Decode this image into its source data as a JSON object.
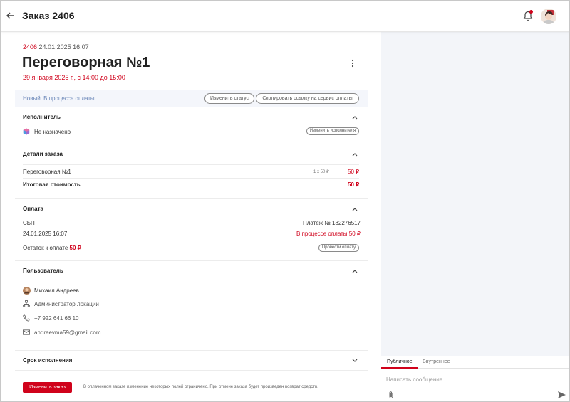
{
  "header": {
    "title": "Заказ 2406"
  },
  "order": {
    "number": "2406",
    "created": "24.01.2025 16:07",
    "room_title": "Переговорная №1",
    "date_line": "29 января 2025 г., с 14:00 до 15:00"
  },
  "status": {
    "text": "Новый. В процессе оплаты",
    "change_status_label": "Изменить статус",
    "copy_link_label": "Скопировать ссылку на сервис оплаты"
  },
  "executor": {
    "title": "Исполнитель",
    "value": "Не назначено",
    "change_label": "Изменить исполнителя"
  },
  "details": {
    "title": "Детали заказа",
    "item_name": "Переговорная №1",
    "item_qty": "1 x 50 ₽",
    "item_price": "50 ₽",
    "total_label": "Итоговая стоимость",
    "total_value": "50 ₽"
  },
  "payment": {
    "title": "Оплата",
    "method": "СБП",
    "payment_id": "Платеж № 182276517",
    "datetime": "24.01.2025 16:07",
    "status": "В процессе оплаты 50 ₽",
    "remaining_label": "Остаток к оплате",
    "remaining_value": "50 ₽",
    "pay_button_label": "Провести оплату"
  },
  "user": {
    "title": "Пользователь",
    "name": "Михаил Андреев",
    "role": "Администратор локации",
    "phone": "+7 922 641 66 10",
    "email": "andreevma59@gmail.com"
  },
  "deadline": {
    "title": "Срок исполнения"
  },
  "footer": {
    "edit_button_label": "Изменить заказ",
    "note": "В оплаченном заказе изменение некоторых полей ограничено. При отмене заказа будет произведен возврат средств."
  },
  "chat": {
    "tab_public": "Публичное",
    "tab_internal": "Внутреннее",
    "placeholder": "Написать сообщение..."
  },
  "colors": {
    "accent": "#d0021b",
    "status_text": "#6b87b8",
    "panel_bg": "#f3f5f9"
  }
}
